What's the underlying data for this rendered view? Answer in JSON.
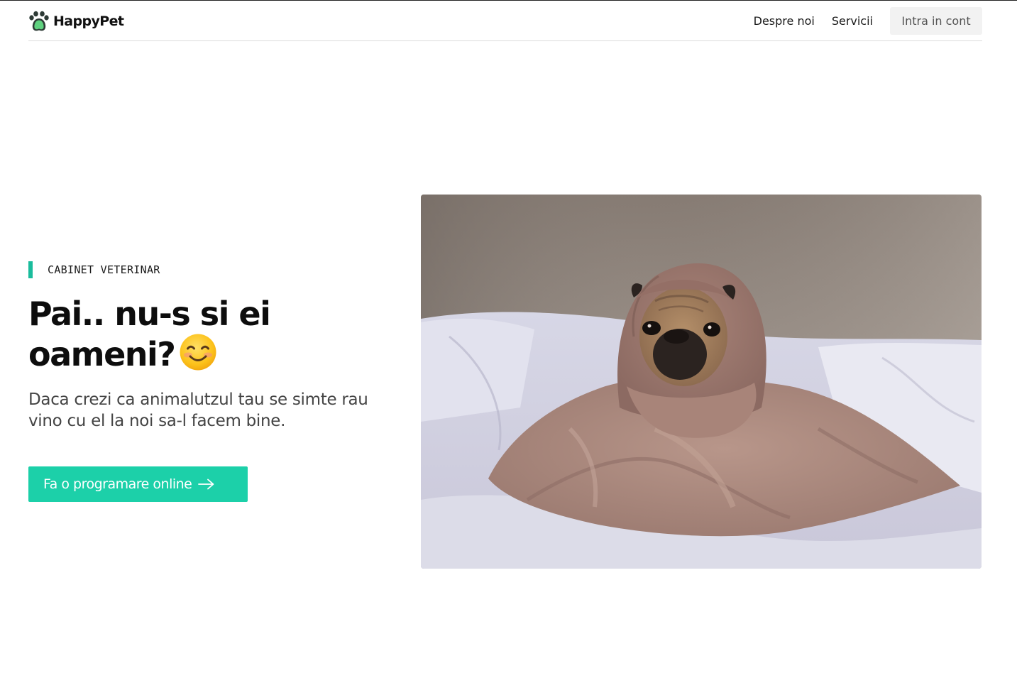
{
  "header": {
    "brand_name": "HappyPet",
    "logo_icon": "paw-icon",
    "nav": {
      "about": "Despre noi",
      "services": "Servicii",
      "login": "Intra in cont"
    }
  },
  "hero": {
    "eyebrow": "CABINET VETERINAR",
    "title": "Pai.. nu-s si ei oameni?",
    "title_emoji": "smiling-face-icon",
    "description": "Daca crezi ca animalutzul tau se simte rau vino cu el la noi sa-l facem bine.",
    "cta": {
      "label": "Fa o programare online",
      "icon": "arrow-right-icon"
    },
    "image": "pug-in-blanket-photo"
  },
  "colors": {
    "accent": "#1abc9c",
    "cta_background": "#1cd0a9",
    "login_background": "#f2f2f2",
    "text_dark": "#111111",
    "text_muted": "#444444"
  }
}
